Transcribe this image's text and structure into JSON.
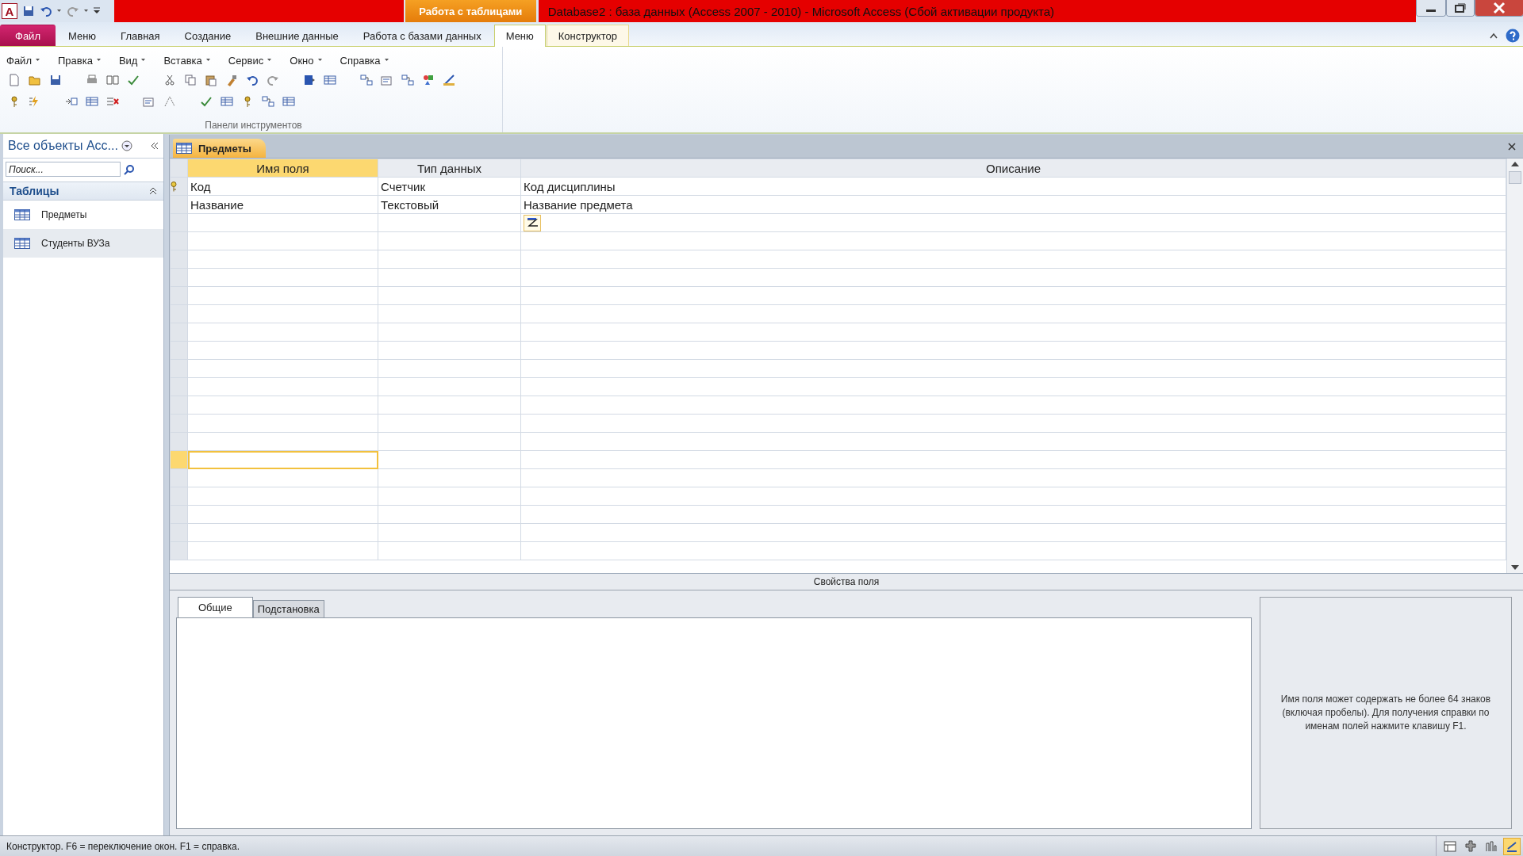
{
  "window": {
    "title": "Database2 : база данных (Access 2007 - 2010)  -  Microsoft Access (Сбой активации продукта)",
    "context_group": "Работа с таблицами",
    "app_letter": "A"
  },
  "ribbon_tabs": [
    {
      "label": "Файл",
      "kind": "file",
      "selected": false
    },
    {
      "label": "Меню",
      "kind": "tab",
      "selected": false
    },
    {
      "label": "Главная",
      "kind": "tab",
      "selected": false
    },
    {
      "label": "Создание",
      "kind": "tab",
      "selected": false
    },
    {
      "label": "Внешние данные",
      "kind": "tab",
      "selected": false
    },
    {
      "label": "Работа с базами данных",
      "kind": "tab",
      "selected": false
    },
    {
      "label": "Меню",
      "kind": "context",
      "selected": true
    },
    {
      "label": "Конструктор",
      "kind": "context",
      "selected": false
    }
  ],
  "menu_bar": [
    "Файл",
    "Правка",
    "Вид",
    "Вставка",
    "Сервис",
    "Окно",
    "Справка"
  ],
  "toolbar_group": "Панели инструментов",
  "nav_pane": {
    "title": "Все объекты Асс...",
    "search": {
      "placeholder": "Поиск..."
    },
    "group": "Таблицы",
    "items": [
      {
        "label": "Предметы",
        "selected": false
      },
      {
        "label": "Студенты ВУЗа",
        "selected": true
      }
    ]
  },
  "document_tab": "Предметы",
  "grid": {
    "columns": [
      "Имя поля",
      "Тип данных",
      "Описание"
    ],
    "rows": [
      {
        "field": "Код",
        "type": "Счетчик",
        "description": "Код дисциплины",
        "key": true,
        "selected": false
      },
      {
        "field": "Название",
        "type": "Текстовый",
        "description": "Название предмета",
        "key": false,
        "selected": false
      },
      {
        "key": false,
        "selected": false,
        "builder": true
      },
      {
        "key": false,
        "selected": false
      },
      {
        "key": false,
        "selected": false
      },
      {
        "key": false,
        "selected": false
      },
      {
        "key": false,
        "selected": false
      },
      {
        "key": false,
        "selected": false
      },
      {
        "key": false,
        "selected": false
      },
      {
        "key": false,
        "selected": false
      },
      {
        "key": false,
        "selected": false
      },
      {
        "key": false,
        "selected": false
      },
      {
        "key": false,
        "selected": false
      },
      {
        "key": false,
        "selected": false
      },
      {
        "key": false,
        "selected": false
      },
      {
        "key": false,
        "selected": true
      },
      {
        "key": false,
        "selected": false
      },
      {
        "key": false,
        "selected": false
      },
      {
        "key": false,
        "selected": false
      },
      {
        "key": false,
        "selected": false
      },
      {
        "key": false,
        "selected": false
      }
    ]
  },
  "properties": {
    "title": "Свойства поля",
    "tabs": [
      {
        "label": "Общие",
        "selected": true
      },
      {
        "label": "Подстановка",
        "selected": false
      }
    ],
    "help": "Имя поля может содержать не более 64 знаков (включая пробелы). Для получения справки по именам полей нажмите клавишу F1."
  },
  "status_bar": {
    "text": "Конструктор.  F6 = переключение окон.  F1 = справка.",
    "views": [
      {
        "selected": false
      },
      {
        "selected": false
      },
      {
        "selected": false
      },
      {
        "selected": true
      }
    ]
  }
}
